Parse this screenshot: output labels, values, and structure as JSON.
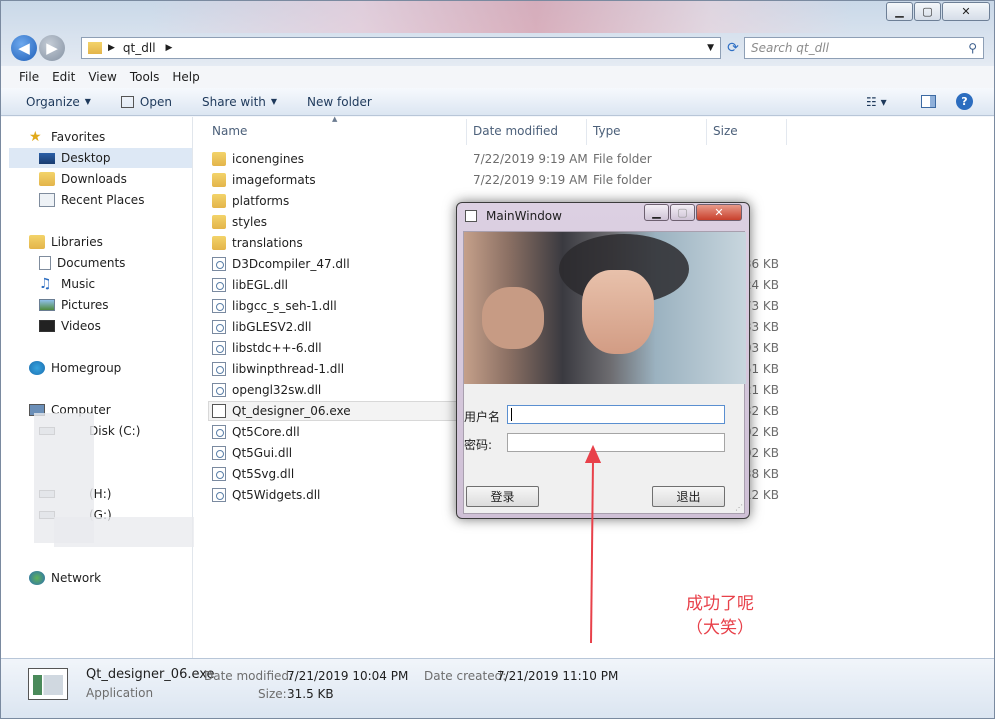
{
  "window": {
    "nav": {
      "path_segment": "qt_dll",
      "search_placeholder": "Search qt_dll"
    },
    "menu": [
      "File",
      "Edit",
      "View",
      "Tools",
      "Help"
    ],
    "toolbar": {
      "organize": "Organize",
      "open": "Open",
      "share_with": "Share with",
      "new_folder": "New folder"
    },
    "sidebar": {
      "favorites": "Favorites",
      "favorites_items": [
        "Desktop",
        "Downloads",
        "Recent Places"
      ],
      "libraries": "Libraries",
      "libraries_items": [
        "Documents",
        "Music",
        "Pictures",
        "Videos"
      ],
      "homegroup": "Homegroup",
      "computer": "Computer",
      "computer_items": [
        "Disk (C:)",
        "(H:)",
        "(G:)"
      ],
      "network": "Network"
    },
    "columns": {
      "name": "Name",
      "date_modified": "Date modified",
      "type": "Type",
      "size": "Size"
    },
    "files": [
      {
        "name": "iconengines",
        "date": "7/22/2019 9:19 AM",
        "type": "File folder",
        "size": ""
      },
      {
        "name": "imageformats",
        "date": "7/22/2019 9:19 AM",
        "type": "File folder",
        "size": ""
      },
      {
        "name": "platforms",
        "date": "",
        "type": "",
        "size": ""
      },
      {
        "name": "styles",
        "date": "",
        "type": "",
        "size": ""
      },
      {
        "name": "translations",
        "date": "",
        "type": "",
        "size": ""
      },
      {
        "name": "D3Dcompiler_47.dll",
        "date": "",
        "type": "",
        "size": "36 KB"
      },
      {
        "name": "libEGL.dll",
        "date": "",
        "type": "",
        "size": "24 KB"
      },
      {
        "name": "libgcc_s_seh-1.dll",
        "date": "",
        "type": "",
        "size": "73 KB"
      },
      {
        "name": "libGLESV2.dll",
        "date": "",
        "type": "",
        "size": "33 KB"
      },
      {
        "name": "libstdc++-6.dll",
        "date": "",
        "type": "",
        "size": "03 KB"
      },
      {
        "name": "libwinpthread-1.dll",
        "date": "",
        "type": "",
        "size": "51 KB"
      },
      {
        "name": "opengl32sw.dll",
        "date": "",
        "type": "",
        "size": "21 KB"
      },
      {
        "name": "Qt_designer_06.exe",
        "date": "",
        "type": "",
        "size": "32 KB"
      },
      {
        "name": "Qt5Core.dll",
        "date": "",
        "type": "",
        "size": "02 KB"
      },
      {
        "name": "Qt5Gui.dll",
        "date": "",
        "type": "",
        "size": "02 KB"
      },
      {
        "name": "Qt5Svg.dll",
        "date": "",
        "type": "",
        "size": "38 KB"
      },
      {
        "name": "Qt5Widgets.dll",
        "date": "",
        "type": "",
        "size": "12 KB"
      }
    ],
    "status": {
      "filename": "Qt_designer_06.exe",
      "filetype": "Application",
      "date_modified_label": "Date modified:",
      "date_modified": "7/21/2019 10:04 PM",
      "date_created_label": "Date created:",
      "date_created": "7/21/2019 11:10 PM",
      "size_label": "Size:",
      "size": "31.5 KB"
    }
  },
  "mainwindow": {
    "title": "MainWindow",
    "username_label": "用户名",
    "password_label": "密码:",
    "login": "登录",
    "exit": "退出"
  },
  "annotation": {
    "line1": "成功了呢",
    "line2": "（大笑）"
  },
  "colors": {
    "annotation": "#e8414a",
    "accent": "#1e395b"
  }
}
